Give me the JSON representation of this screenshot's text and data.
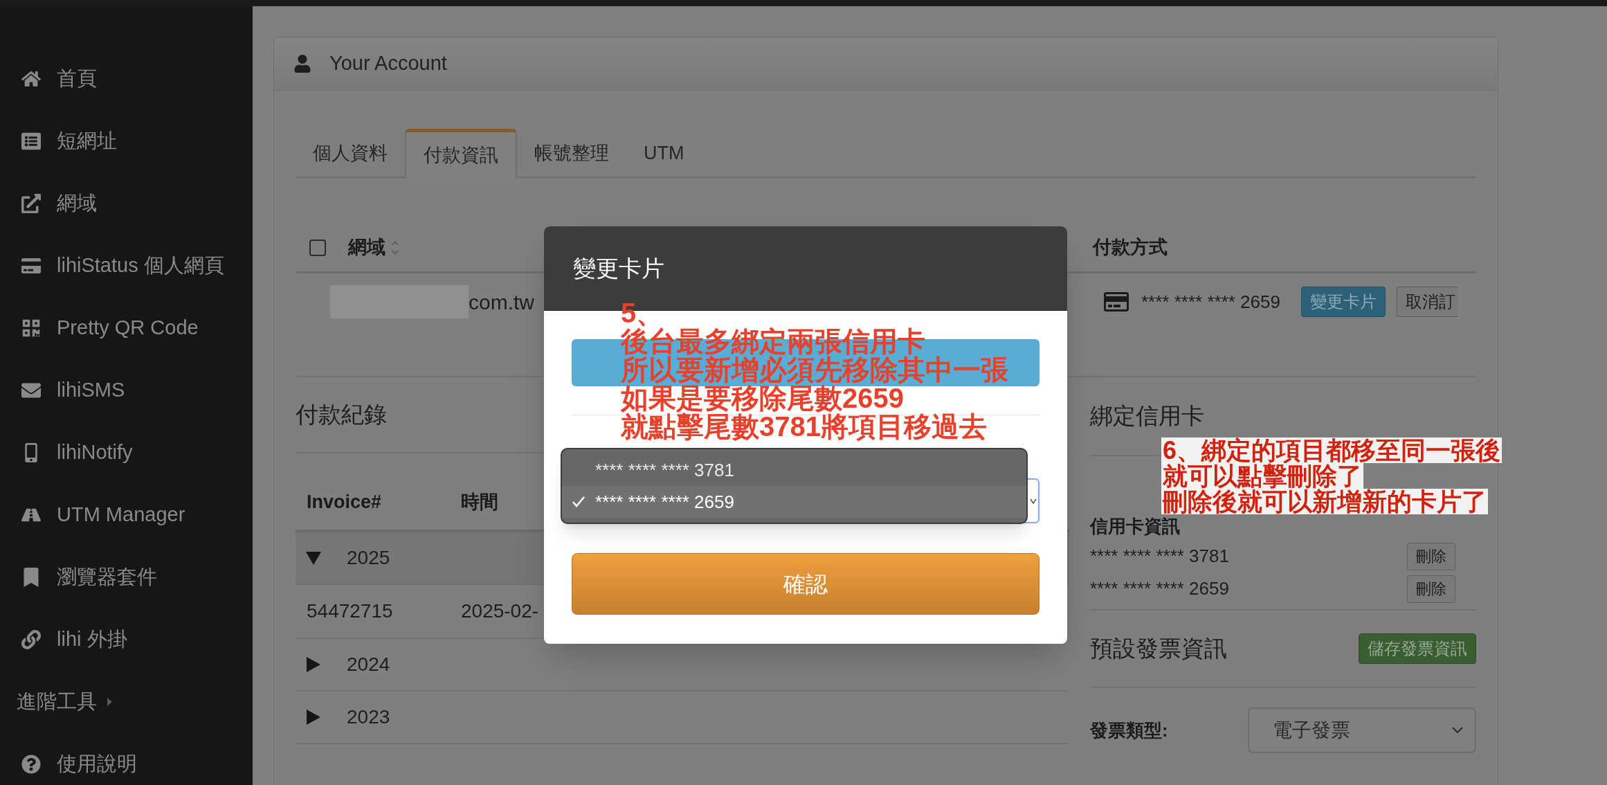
{
  "sidebar": {
    "items": [
      {
        "label": "首頁",
        "kind": "link"
      },
      {
        "label": "短網址",
        "kind": "link"
      },
      {
        "label": "網域",
        "kind": "link"
      },
      {
        "label": "lihiStatus 個人網頁",
        "kind": "link"
      },
      {
        "label": "Pretty QR Code",
        "kind": "link"
      },
      {
        "label": "lihiSMS",
        "kind": "link"
      },
      {
        "label": "lihiNotify",
        "kind": "link"
      },
      {
        "label": "UTM Manager",
        "kind": "link"
      },
      {
        "label": "瀏覽器套件",
        "kind": "link"
      },
      {
        "label": "lihi 外掛",
        "kind": "link"
      },
      {
        "label": "進階工具",
        "kind": "group",
        "expanded": false
      },
      {
        "label": "使用說明",
        "kind": "link"
      }
    ]
  },
  "panel": {
    "title": "Your Account",
    "tabs": [
      {
        "label": "個人資料",
        "selected": false
      },
      {
        "label": "付款資訊",
        "selected": true
      },
      {
        "label": "帳號整理",
        "selected": false
      },
      {
        "label": "UTM",
        "selected": false
      }
    ],
    "domains_table": {
      "select_all_checked": false,
      "columns": [
        "網域",
        "付款方式"
      ],
      "rows": [
        {
          "domain": "com.tw",
          "card": "**** **** **** 2659",
          "buttons": [
            "變更卡片",
            "取消訂"
          ]
        }
      ]
    },
    "payment_history": {
      "title": "付款紀錄",
      "columns": [
        "Invoice#",
        "時間"
      ],
      "groups": [
        {
          "year": "2025",
          "expanded": true,
          "rows": [
            {
              "invoice": "54472715",
              "time": "2025-02-"
            }
          ]
        },
        {
          "year": "2024",
          "expanded": false
        },
        {
          "year": "2023",
          "expanded": false
        }
      ]
    },
    "bound_cards": {
      "title": "綁定信用卡",
      "subtitle": "信用卡資訊",
      "cards": [
        {
          "number": "**** **** **** 3781",
          "button": "刪除"
        },
        {
          "number": "**** **** **** 2659",
          "button": "刪除"
        }
      ]
    },
    "invoice": {
      "title": "預設發票資訊",
      "save_button": "儲存發票資訊",
      "type_label": "發票類型:",
      "type_value": "電子發票"
    }
  },
  "modal": {
    "title": "變更卡片",
    "options": [
      {
        "label": "**** **** **** 3781",
        "selected": false
      },
      {
        "label": "**** **** **** 2659",
        "selected": true
      }
    ],
    "confirm": "確認"
  },
  "annotations": [
    {
      "lines": [
        "5、",
        "後台最多綁定兩張信用卡",
        "所以要新增必須先移除其中一張",
        "如果是要移除尾數2659",
        "就點擊尾數3781將項目移過去"
      ]
    },
    {
      "lines": [
        "6、綁定的項目都移至同一張後",
        "就可以點擊刪除了",
        "刪除後就可以新增新的卡片了"
      ]
    }
  ]
}
